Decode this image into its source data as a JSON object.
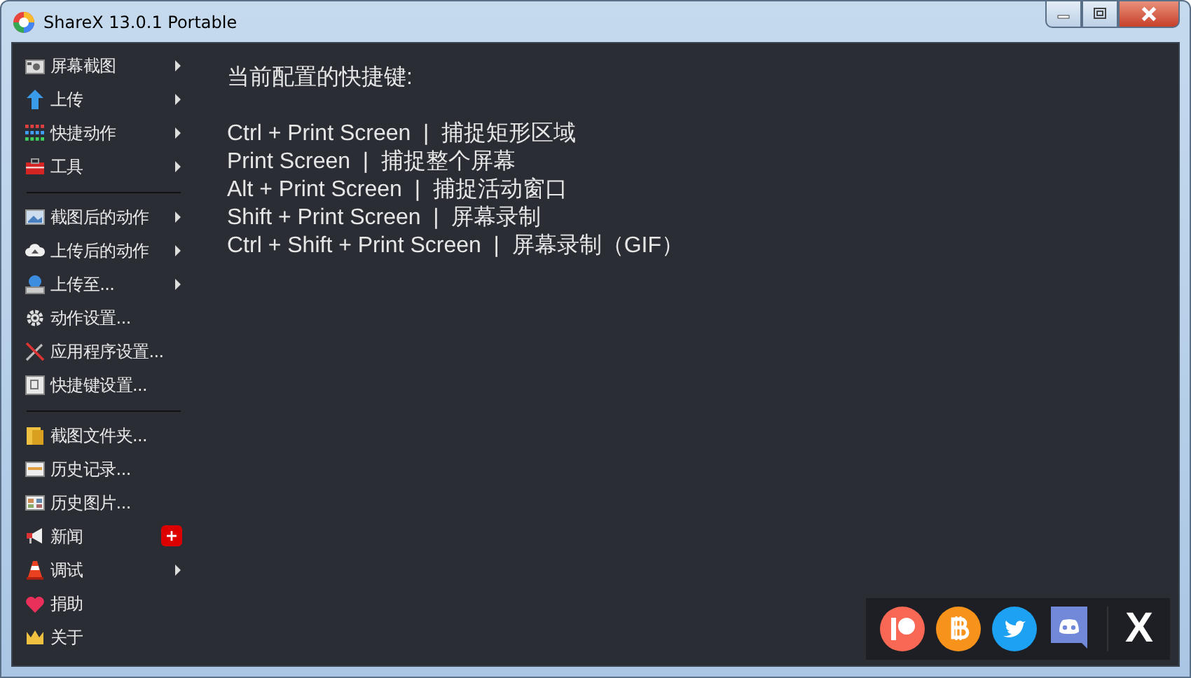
{
  "window": {
    "title": "ShareX 13.0.1 Portable"
  },
  "menu": [
    {
      "kind": "item",
      "label": "屏幕截图",
      "submenu": true
    },
    {
      "kind": "item",
      "label": "上传",
      "submenu": true
    },
    {
      "kind": "item",
      "label": "快捷动作",
      "submenu": true
    },
    {
      "kind": "item",
      "label": "工具",
      "submenu": true
    },
    {
      "kind": "separator"
    },
    {
      "kind": "item",
      "label": "截图后的动作",
      "submenu": true
    },
    {
      "kind": "item",
      "label": "上传后的动作",
      "submenu": true
    },
    {
      "kind": "item",
      "label": "上传至...",
      "submenu": true
    },
    {
      "kind": "item",
      "label": "动作设置...",
      "submenu": false
    },
    {
      "kind": "item",
      "label": "应用程序设置...",
      "submenu": false
    },
    {
      "kind": "item",
      "label": "快捷键设置...",
      "submenu": false
    },
    {
      "kind": "separator"
    },
    {
      "kind": "item",
      "label": "截图文件夹...",
      "submenu": false
    },
    {
      "kind": "item",
      "label": "历史记录...",
      "submenu": false
    },
    {
      "kind": "item",
      "label": "历史图片...",
      "submenu": false
    },
    {
      "kind": "item",
      "label": "新闻",
      "submenu": false,
      "badge": "+"
    },
    {
      "kind": "item",
      "label": "调试",
      "submenu": true
    },
    {
      "kind": "item",
      "label": "捐助",
      "submenu": false
    },
    {
      "kind": "item",
      "label": "关于",
      "submenu": false
    }
  ],
  "hotkeys": {
    "heading": "当前配置的快捷键:",
    "lines": [
      "Ctrl + Print Screen  |  捕捉矩形区域",
      "Print Screen  |  捕捉整个屏幕",
      "Alt + Print Screen  |  捕捉活动窗口",
      "Shift + Print Screen  |  屏幕录制",
      "Ctrl + Shift + Print Screen  |  屏幕录制（GIF）"
    ]
  },
  "social": {
    "logo_text": "X"
  }
}
